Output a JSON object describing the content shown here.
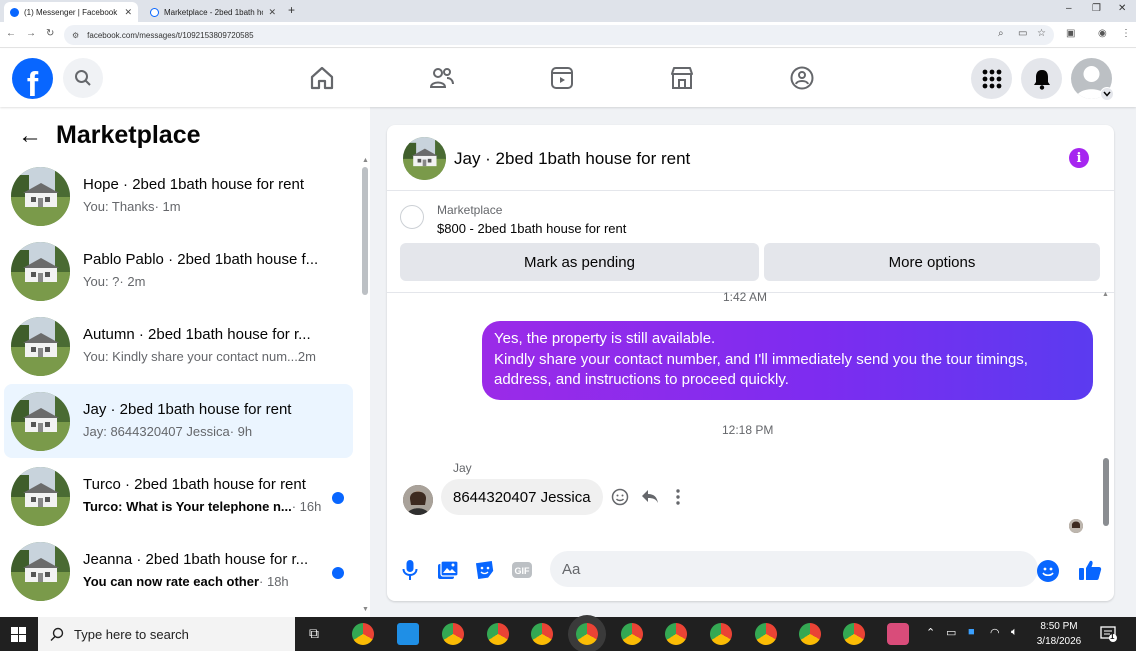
{
  "browser": {
    "tabs": [
      {
        "title": "(1) Messenger | Facebook",
        "active": true
      },
      {
        "title": "Marketplace - 2bed 1bath hous",
        "active": false
      }
    ],
    "url": "facebook.com/messages/t/1092153809720585"
  },
  "sidebar": {
    "title": "Marketplace",
    "conversations": [
      {
        "name": "Hope · 2bed 1bath house for rent",
        "snippet": "You: Thanks",
        "time": " · 1m",
        "unread": false
      },
      {
        "name": "Pablo Pablo · 2bed 1bath house f...",
        "snippet": "You: ?",
        "time": " · 2m",
        "unread": false
      },
      {
        "name": "Autumn · 2bed 1bath house for r...",
        "snippet": "You: Kindly share your contact num...",
        "time": "  2m",
        "unread": false
      },
      {
        "name": "Jay · 2bed 1bath house for rent",
        "snippet": "Jay: 8644320407 Jessica",
        "time": " · 9h",
        "unread": false
      },
      {
        "name": "Turco · 2bed 1bath house for rent",
        "snippet": "Turco: What is Your telephone n...",
        "time": " · 16h",
        "unread": true
      },
      {
        "name": "Jeanna · 2bed 1bath house for r...",
        "snippet": "You can now rate each other",
        "time": " · 18h",
        "unread": true
      }
    ]
  },
  "chat": {
    "title": "Jay · 2bed 1bath house for rent",
    "listing": {
      "label": "Marketplace",
      "price_title": "$800 - 2bed 1bath house for rent",
      "pending_label": "Mark as pending",
      "more_label": "More options"
    },
    "timestamp1": "1:42 AM",
    "outgoing": {
      "line1": "Yes, the property is still available.",
      "line2": "Kindly share your contact number, and I'll immediately send you the tour timings,",
      "line3": "address, and instructions to proceed quickly."
    },
    "timestamp2": "12:18 PM",
    "sender": "Jay",
    "incoming": "8644320407 Jessica",
    "composer_placeholder": "Aa"
  },
  "taskbar": {
    "search_placeholder": "Type here to search",
    "time": "8:50 PM",
    "date": "3/18/2026",
    "notification_count": "1"
  },
  "colors": {
    "brand": "#0866ff",
    "bubble_start": "#9b2be8",
    "bubble_end": "#5b3bf0",
    "info": "#a626f0",
    "unread_dot": "#0866ff"
  }
}
